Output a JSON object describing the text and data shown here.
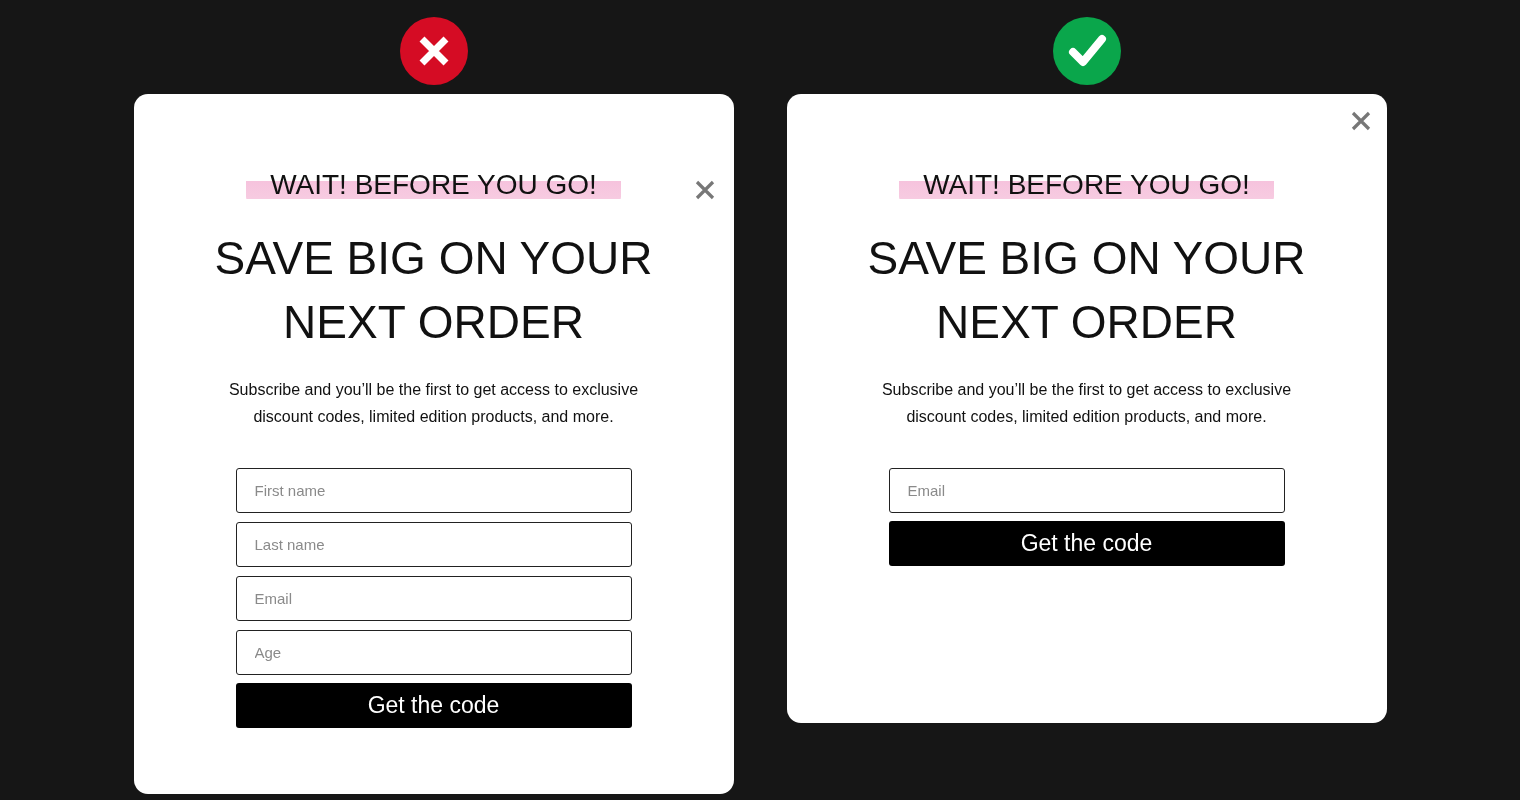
{
  "panels": [
    {
      "kind": "bad",
      "kicker": "WAIT! BEFORE YOU GO!",
      "title_lines": [
        "SAVE BIG ON YOUR",
        "NEXT ORDER"
      ],
      "text": "Subscribe and you’ll be the first to get access to exclusive discount codes, limited edition products, and more.",
      "fields": [
        {
          "placeholder": "First name"
        },
        {
          "placeholder": "Last name"
        },
        {
          "placeholder": "Email"
        },
        {
          "placeholder": "Age"
        }
      ],
      "button": "Get the code"
    },
    {
      "kind": "good",
      "kicker": "WAIT! BEFORE YOU GO!",
      "title_lines": [
        "SAVE BIG ON YOUR",
        "NEXT ORDER"
      ],
      "text": "Subscribe and you’ll be the first to get access to exclusive discount codes, limited edition products, and more.",
      "fields": [
        {
          "placeholder": "Email"
        }
      ],
      "button": "Get the code"
    }
  ]
}
